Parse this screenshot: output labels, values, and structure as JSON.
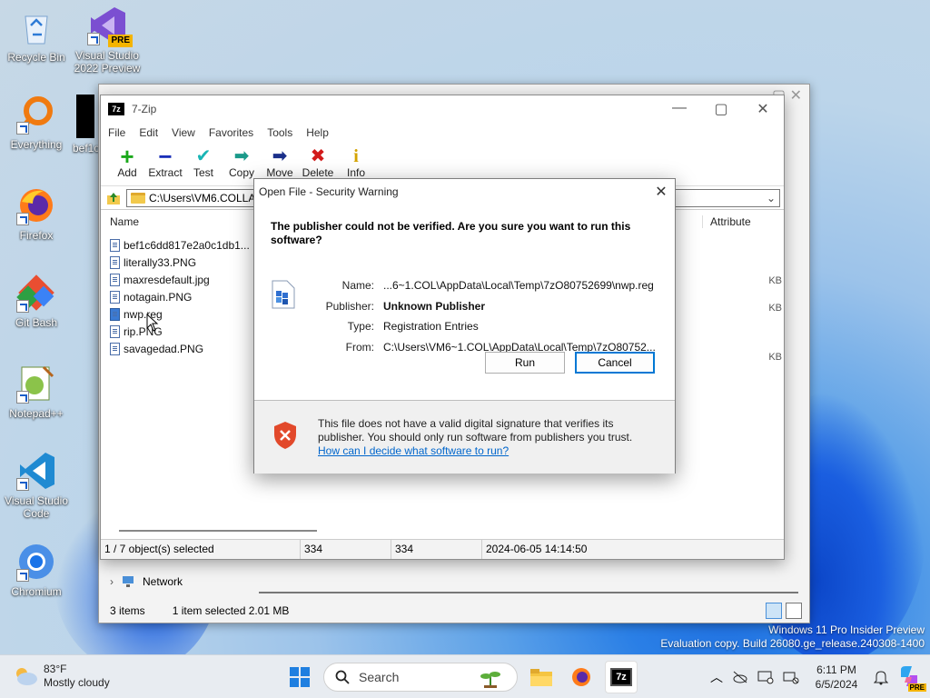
{
  "desktop": {
    "icons": [
      {
        "label": "Recycle Bin"
      },
      {
        "label": "Visual Studio 2022 Preview",
        "badge": "PRE"
      },
      {
        "label": "Everything"
      },
      {
        "label": "bef1c"
      },
      {
        "label": "Firefox"
      },
      {
        "label": "Git Bash"
      },
      {
        "label": "Notepad++"
      },
      {
        "label": "Visual Studio Code"
      },
      {
        "label": "Chromium"
      }
    ],
    "watermark_line1": "Windows 11 Pro Insider Preview",
    "watermark_line2": "Evaluation copy. Build 26080.ge_release.240308-1400"
  },
  "explorer": {
    "nav_network": "Network",
    "status_items": "3 items",
    "status_selected": "1 item selected  2.01 MB"
  },
  "zip": {
    "title": "7-Zip",
    "app_icon": "7z",
    "menu": [
      "File",
      "Edit",
      "View",
      "Favorites",
      "Tools",
      "Help"
    ],
    "toolbar": [
      {
        "label": "Add",
        "icon": "+",
        "color": "#1aa81a"
      },
      {
        "label": "Extract",
        "icon": "−",
        "color": "#1a2fb8"
      },
      {
        "label": "Test",
        "icon": "✔",
        "color": "#19b5b5"
      },
      {
        "label": "Copy",
        "icon": "➡",
        "color": "#1a9a8a"
      },
      {
        "label": "Move",
        "icon": "➡",
        "color": "#1a2f8a"
      },
      {
        "label": "Delete",
        "icon": "✖",
        "color": "#d21a1a"
      },
      {
        "label": "Info",
        "icon": "i",
        "color": "#d4a300"
      }
    ],
    "address": "C:\\Users\\VM6.COLLA",
    "column_name": "Name",
    "column_attr": "Attribute",
    "files": [
      "bef1c6dd817e2a0c1db1...",
      "literally33.PNG",
      "maxresdefault.jpg",
      "notagain.PNG",
      "nwp.reg",
      "rip.PNG",
      "savagedad.PNG"
    ],
    "kb_label": "KB",
    "status": [
      "1 / 7 object(s) selected",
      "334",
      "334",
      "2024-06-05 14:14:50"
    ]
  },
  "dialog": {
    "title": "Open File - Security Warning",
    "question": "The publisher could not be verified.  Are you sure you want to run this software?",
    "name_label": "Name:",
    "name_value": "...6~1.COL\\AppData\\Local\\Temp\\7zO80752699\\nwp.reg",
    "publisher_label": "Publisher:",
    "publisher_value": "Unknown Publisher",
    "type_label": "Type:",
    "type_value": "Registration Entries",
    "from_label": "From:",
    "from_value": "C:\\Users\\VM6~1.COL\\AppData\\Local\\Temp\\7zO80752...",
    "run_label": "Run",
    "cancel_label": "Cancel",
    "warning_text": "This file does not have a valid digital signature that verifies its publisher.  You should only run software from publishers you trust.",
    "help_link": "How can I decide what software to run?"
  },
  "taskbar": {
    "temperature": "83°F",
    "weather": "Mostly cloudy",
    "search_placeholder": "Search",
    "time": "6:11 PM",
    "date": "6/5/2024",
    "copilot_badge": "PRE"
  }
}
